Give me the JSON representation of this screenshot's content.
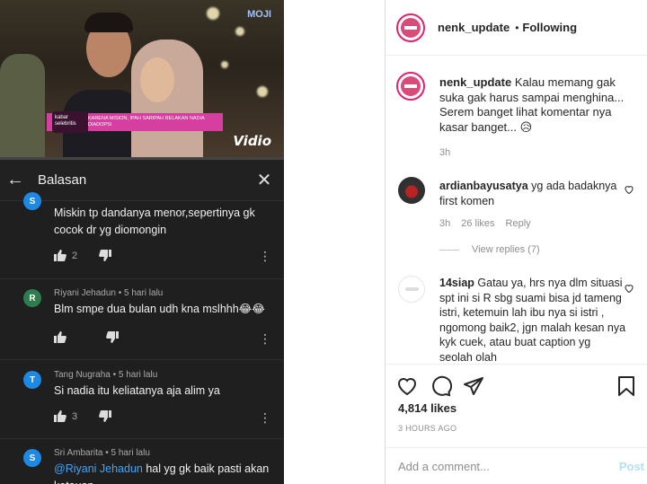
{
  "left": {
    "video": {
      "caption_text": "KARENA MISION, IPAH SARIPAH RELAKAN NADIA DIADOPSI",
      "caption_logo": "kabar selebritis",
      "tv_logo": "MOJI",
      "brand": "Vidio"
    },
    "replies": {
      "title": "Balasan",
      "items": [
        {
          "avatar": "S",
          "avatar_color": "#1e88e5",
          "author": "",
          "time": "",
          "text": "Miskin tp dandanya menor,sepertinya gk cocok dr yg diomongin",
          "likes": "2"
        },
        {
          "avatar": "R",
          "avatar_color": "#2e7d4f",
          "author": "Riyani Jehadun",
          "time": "5 hari lalu",
          "text": "Blm smpe dua bulan udh kna mslhhh😂😂",
          "likes": ""
        },
        {
          "avatar": "T",
          "avatar_color": "#1e88e5",
          "author": "Tang Nugraha",
          "time": "5 hari lalu",
          "text": "Si nadia itu keliatanya aja alim ya",
          "likes": "3"
        },
        {
          "avatar": "S",
          "avatar_color": "#1e88e5",
          "author": "Sri Ambarita",
          "time": "5 hari lalu",
          "mention": "@Riyani Jehadun",
          "text": " hal yg gk baik pasti akan ketauan",
          "likes": ""
        }
      ]
    }
  },
  "right": {
    "header": {
      "username": "nenk_update",
      "dot": "•",
      "following": "Following"
    },
    "caption": {
      "username": "nenk_update",
      "text": "Kalau memang gak suka gak harus sampai menghina... Serem banget lihat komentar nya kasar banget... 😥",
      "time": "3h"
    },
    "comments": [
      {
        "username": "ardianbayusatya",
        "text": "yg ada badaknya first komen",
        "time": "3h",
        "likes": "26 likes",
        "reply": "Reply",
        "view_replies": "View replies (7)"
      },
      {
        "username": "14siap",
        "text": "Gatau ya, hrs nya dlm situasi spt ini si R sbg suami bisa jd tameng istri, ketemuin lah ibu nya si istri , ngomong baik2, jgn malah kesan nya kyk cuek, atau buat caption yg seolah olah"
      }
    ],
    "likes": "4,814 likes",
    "posted": "3 HOURS AGO",
    "add_comment_placeholder": "Add a comment...",
    "post_label": "Post"
  }
}
